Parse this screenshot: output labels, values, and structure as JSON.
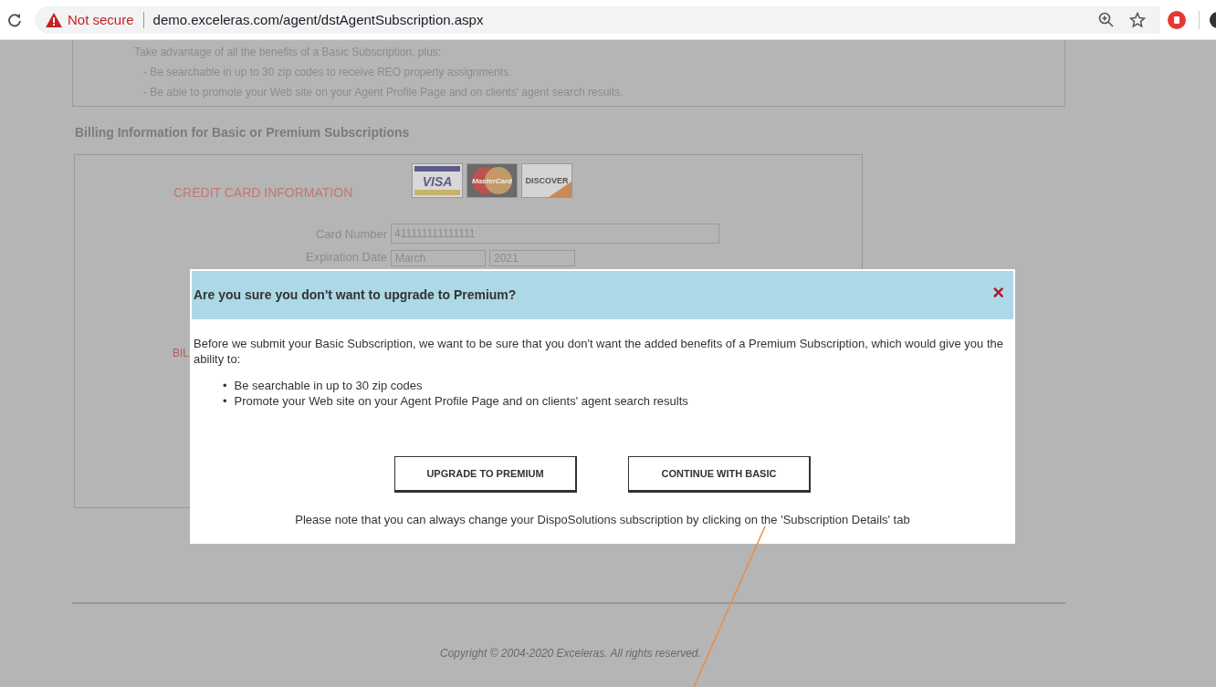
{
  "browser": {
    "security_label": "Not secure",
    "url": "demo.exceleras.com/agent/dstAgentSubscription.aspx"
  },
  "premium_box": {
    "intro": "Take advantage of all the benefits of a Basic Subscription, plus:",
    "benefits": [
      "- Be searchable in up to 30 zip codes to receive REO property assignments.",
      "- Be able to promote your Web site on your Agent Profile Page and on clients' agent search results."
    ]
  },
  "billing": {
    "heading": "Billing Information for Basic or Premium Subscriptions",
    "card_section_title": "CREDIT CARD INFORMATION",
    "card_logos": [
      {
        "kind": "visa",
        "text": "VISA"
      },
      {
        "kind": "mastercard",
        "text": "MasterCard"
      },
      {
        "kind": "discover",
        "text": "DISCOVER"
      }
    ],
    "card_number": {
      "label": "Card Number",
      "value": "411111111111111"
    },
    "expiration": {
      "label": "Expiration Date",
      "month": "March",
      "year": "2021"
    },
    "billing_section_title": "BIL"
  },
  "footer": {
    "copyright": "Copyright © 2004-2020 Exceleras. All rights reserved."
  },
  "dialog": {
    "title": "Are you sure you don't want to upgrade to Premium?",
    "close": "×",
    "message": "Before we submit your Basic Subscription, we want to be sure that you don't want the added benefits of a Premium Subscription, which would give you the ability to:",
    "benefits": [
      {
        "marker": "•",
        "text": "Be searchable in up to 30 zip codes"
      },
      {
        "marker": "•",
        "text": "Promote your Web site on your Agent Profile Page and on clients' agent search results"
      }
    ],
    "buttons": [
      "UPGRADE TO PREMIUM",
      "CONTINUE WITH BASIC"
    ],
    "note": "Please note that you can always change your DispoSolutions subscription by clicking on the 'Subscription Details' tab"
  }
}
